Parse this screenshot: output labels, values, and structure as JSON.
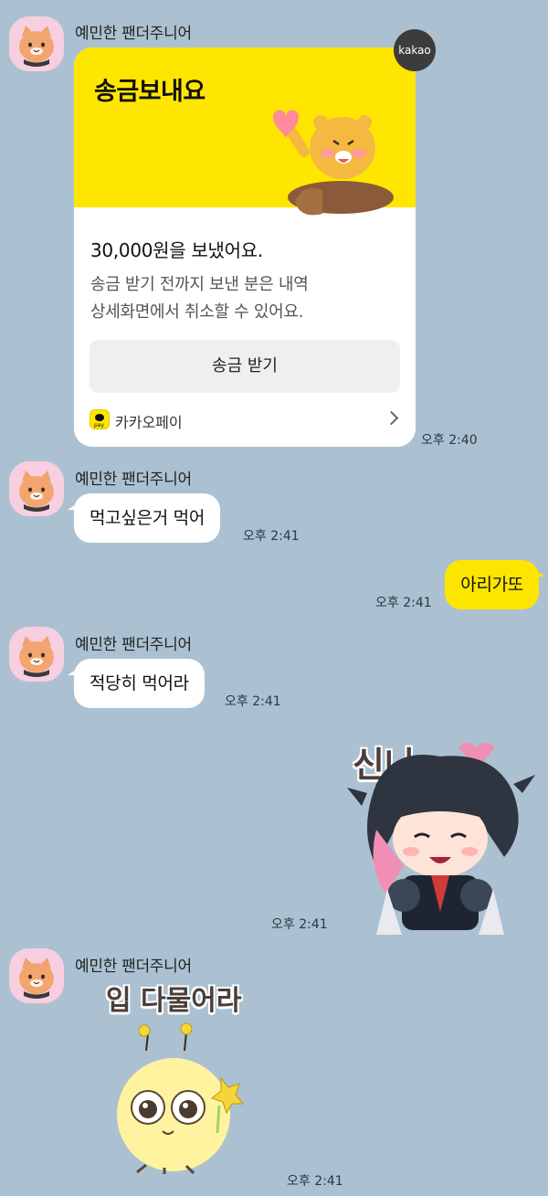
{
  "sender_name": "예민한 팬더주니어",
  "pay_card": {
    "badge": "kakao",
    "title": "송금보내요",
    "amount_text": "30,000원을 보냈어요.",
    "desc_line1": "송금 받기 전까지 보낸 분은 내역",
    "desc_line2": "상세화면에서 취소할 수 있어요.",
    "button_label": "송금 받기",
    "footer_label": "카카오페이",
    "pay_icon_text": "pay",
    "time": "오후 2:40"
  },
  "messages": [
    {
      "text": "먹고싶은거 먹어",
      "time": "오후 2:41"
    },
    {
      "text": "아리가또",
      "time": "오후 2:41"
    },
    {
      "text": "적당히 먹어라",
      "time": "오후 2:41"
    }
  ],
  "stickers": [
    {
      "caption": "신나",
      "time": "오후 2:41"
    },
    {
      "caption": "입 다물어라",
      "time": "오후 2:41"
    }
  ],
  "colors": {
    "background": "#abc1d1",
    "my_bubble": "#fee500",
    "their_bubble": "#ffffff",
    "pay_yellow": "#ffe600"
  }
}
